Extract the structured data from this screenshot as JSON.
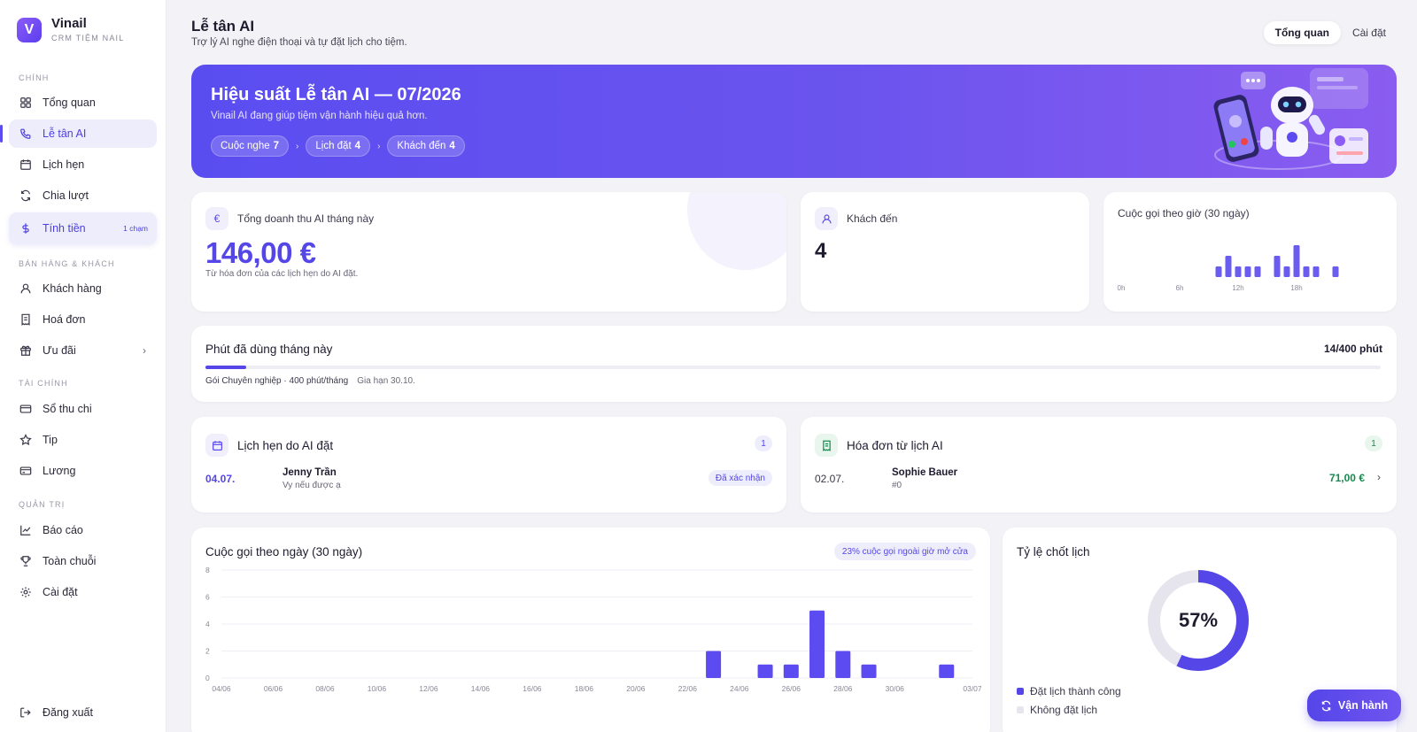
{
  "brand": {
    "name": "Vinail",
    "sub": "CRM TIỆM NAIL"
  },
  "sidebar": {
    "sections": [
      {
        "label": "CHÍNH"
      },
      {
        "label": "BÁN HÀNG & KHÁCH"
      },
      {
        "label": "TÀI CHÍNH"
      },
      {
        "label": "QUẢN TRỊ"
      }
    ],
    "items": [
      {
        "label": "Tổng quan",
        "icon": "grid-icon"
      },
      {
        "label": "Lễ tân AI",
        "icon": "phone-icon",
        "active": true
      },
      {
        "label": "Lịch hẹn",
        "icon": "calendar-icon"
      },
      {
        "label": "Chia lượt",
        "icon": "refresh-icon"
      },
      {
        "label": "Tính tiền",
        "icon": "dollar-icon",
        "badge": "1 chạm"
      },
      {
        "label": "Khách hàng",
        "icon": "user-icon"
      },
      {
        "label": "Hoá đơn",
        "icon": "receipt-icon"
      },
      {
        "label": "Ưu đãi",
        "icon": "gift-icon"
      },
      {
        "label": "Sổ thu chi",
        "icon": "wallet-icon"
      },
      {
        "label": "Tip",
        "icon": "star-icon"
      },
      {
        "label": "Lương",
        "icon": "card-icon"
      },
      {
        "label": "Báo cáo",
        "icon": "chart-line-icon"
      },
      {
        "label": "Toàn chuỗi",
        "icon": "trophy-icon"
      },
      {
        "label": "Cài đặt",
        "icon": "gear-icon"
      }
    ],
    "logout": "Đăng xuất"
  },
  "header": {
    "title": "Lễ tân AI",
    "subtitle": "Trợ lý AI nghe điện thoại và tự đặt lịch cho tiệm.",
    "tabs": [
      "Tổng quan",
      "Cài đặt"
    ]
  },
  "hero": {
    "title": "Hiệu suất Lễ tân AI — 07/2026",
    "subtitle": "Vinail AI đang giúp tiệm vận hành hiệu quả hơn.",
    "chips": [
      {
        "label": "Cuộc nghe",
        "value": "7"
      },
      {
        "label": "Lịch đặt",
        "value": "4"
      },
      {
        "label": "Khách đến",
        "value": "4"
      }
    ]
  },
  "revenue": {
    "label": "Tổng doanh thu AI tháng này",
    "icon": "euro",
    "value": "146,00 €",
    "note": "Từ hóa đơn của các lịch hẹn do AI đặt."
  },
  "customers": {
    "label": "Khách đến",
    "value": "4"
  },
  "hourly": {
    "title": "Cuộc gọi theo giờ (30 ngày)",
    "ticks": [
      "0h",
      "6h",
      "12h",
      "18h"
    ]
  },
  "minutes": {
    "title": "Phút đã dùng tháng này",
    "value": "14/400 phút",
    "used_fraction": 0.035,
    "plan": "Gói Chuyên nghiệp · 400 phút/tháng",
    "renew": "Gia hạn 30.10."
  },
  "appointments": {
    "title": "Lịch hẹn do AI đặt",
    "count": "1",
    "rows": [
      {
        "date": "04.07.",
        "name": "Jenny Trần",
        "note": "Vy nếu được ạ",
        "status": "Đã xác nhận"
      }
    ]
  },
  "invoices": {
    "title": "Hóa đơn từ lịch AI",
    "count": "1",
    "rows": [
      {
        "date": "02.07.",
        "name": "Sophie Bauer",
        "number": "#0",
        "amount": "71,00 €"
      }
    ]
  },
  "daily": {
    "title": "Cuộc gọi theo ngày (30 ngày)",
    "pill": "23% cuộc gọi ngoài giờ mở cửa"
  },
  "rate": {
    "title": "Tỷ lệ chốt lịch",
    "value_label": "57%",
    "fraction": 0.57,
    "legend": [
      {
        "label": "Đặt lịch thành công",
        "color": "#5546e8"
      },
      {
        "label": "Không đặt lịch",
        "color": "#e6e5ee"
      }
    ]
  },
  "fab": {
    "label": "Vận hành"
  },
  "colors": {
    "accent": "#5546e8",
    "success": "#178a4f"
  },
  "chart_data": [
    {
      "type": "bar",
      "title": "Cuộc gọi theo giờ (30 ngày)",
      "x": [
        10,
        11,
        12,
        13,
        14,
        16,
        17,
        18,
        19,
        20,
        22
      ],
      "values": [
        1,
        2,
        1,
        1,
        1,
        2,
        1,
        3,
        1,
        1,
        1
      ],
      "xticks": [
        "0h",
        "6h",
        "12h",
        "18h"
      ],
      "xlim": [
        0,
        24
      ]
    },
    {
      "type": "bar",
      "title": "Cuộc gọi theo ngày (30 ngày)",
      "categories": [
        "04/06",
        "05/06",
        "06/06",
        "07/06",
        "08/06",
        "09/06",
        "10/06",
        "11/06",
        "12/06",
        "13/06",
        "14/06",
        "15/06",
        "16/06",
        "17/06",
        "18/06",
        "19/06",
        "20/06",
        "21/06",
        "22/06",
        "23/06",
        "24/06",
        "25/06",
        "26/06",
        "27/06",
        "28/06",
        "29/06",
        "30/06",
        "01/07",
        "02/07",
        "03/07"
      ],
      "values": [
        0,
        0,
        0,
        0,
        0,
        0,
        0,
        0,
        0,
        0,
        0,
        0,
        0,
        0,
        0,
        0,
        0,
        0,
        0,
        2,
        0,
        1,
        1,
        5,
        2,
        1,
        0,
        0,
        1,
        0
      ],
      "xticks": [
        "04/06",
        "06/06",
        "08/06",
        "10/06",
        "12/06",
        "14/06",
        "16/06",
        "18/06",
        "20/06",
        "22/06",
        "24/06",
        "26/06",
        "28/06",
        "30/06",
        "03/07"
      ],
      "yticks": [
        "0",
        "2",
        "4",
        "6",
        "8"
      ],
      "ylim": [
        0,
        8
      ],
      "grid": true
    },
    {
      "type": "pie",
      "title": "Tỷ lệ chốt lịch",
      "categories": [
        "Đặt lịch thành công",
        "Không đặt lịch"
      ],
      "values": [
        57,
        43
      ]
    }
  ]
}
